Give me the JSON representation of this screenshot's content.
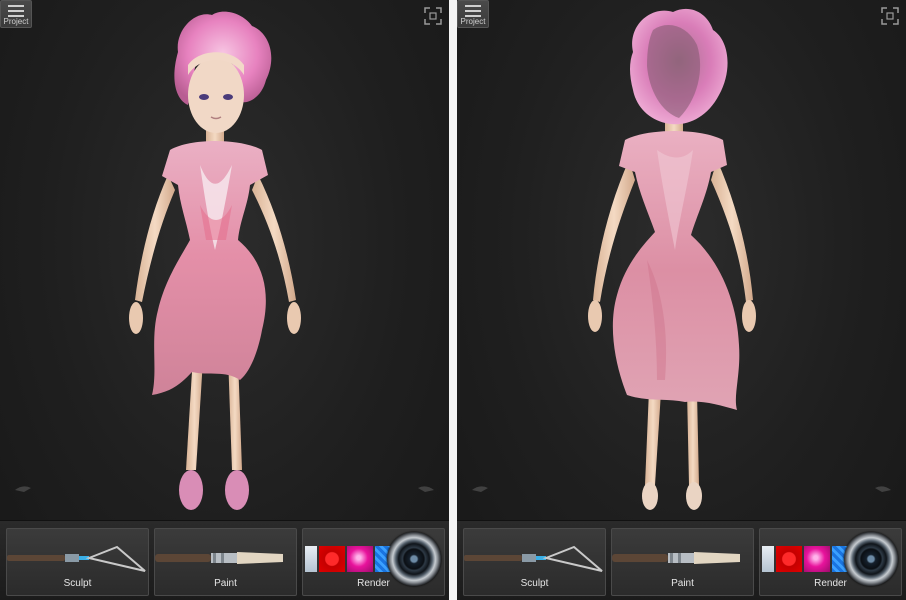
{
  "screens": [
    {
      "view": "front",
      "menu": {
        "label": "Project",
        "icon": "hamburger-menu-icon"
      },
      "fit_icon": "fit-to-screen-icon",
      "toolbar": {
        "sculpt": {
          "label": "Sculpt",
          "icon": "sculpt-tool-icon"
        },
        "paint": {
          "label": "Paint",
          "icon": "paint-brush-icon"
        },
        "render": {
          "label": "Render",
          "icon": "camera-lens-icon"
        }
      }
    },
    {
      "view": "back",
      "menu": {
        "label": "Project",
        "icon": "hamburger-menu-icon"
      },
      "fit_icon": "fit-to-screen-icon",
      "toolbar": {
        "sculpt": {
          "label": "Sculpt",
          "icon": "sculpt-tool-icon"
        },
        "paint": {
          "label": "Paint",
          "icon": "paint-brush-icon"
        },
        "render": {
          "label": "Render",
          "icon": "camera-lens-icon"
        }
      }
    }
  ],
  "colors": {
    "viewport_bg": "#222222",
    "dress_pink": "#e8a0b8",
    "hair_pink": "#ec8fc4",
    "skin": "#f0d2b8"
  }
}
